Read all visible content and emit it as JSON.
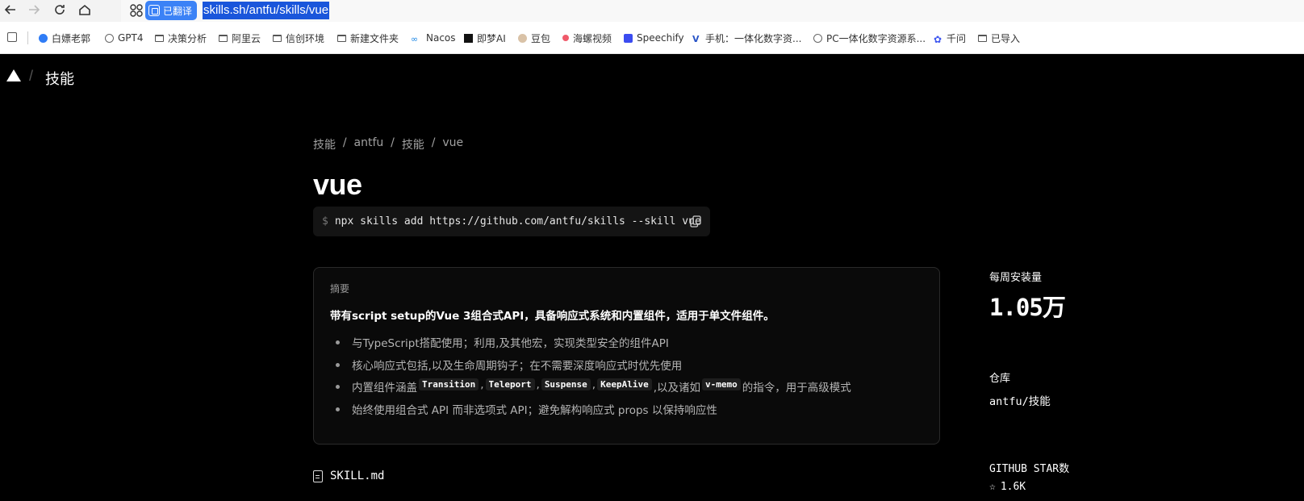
{
  "browser": {
    "translated_badge": "已翻译",
    "url": "skills.sh/antfu/skills/vue"
  },
  "bookmarks": [
    {
      "label": "白嫖老郭",
      "icon": "globe-icon"
    },
    {
      "label": "GPT4",
      "icon": "openai-icon"
    },
    {
      "label": "决策分析",
      "icon": "folder-icon"
    },
    {
      "label": "阿里云",
      "icon": "folder-icon"
    },
    {
      "label": "信创环境",
      "icon": "folder-icon"
    },
    {
      "label": "新建文件夹",
      "icon": "folder-icon"
    },
    {
      "label": "Nacos",
      "icon": "nacos-icon"
    },
    {
      "label": "即梦AI",
      "icon": "jimeng-icon"
    },
    {
      "label": "豆包",
      "icon": "doubao-icon"
    },
    {
      "label": "海螺视频",
      "icon": "hailuo-icon"
    },
    {
      "label": "Speechify",
      "icon": "speechify-icon"
    },
    {
      "label": "手机：一体化数字资...",
      "icon": "v-icon"
    },
    {
      "label": "PC一体化数字资源系...",
      "icon": "openai-icon"
    },
    {
      "label": "千问",
      "icon": "qianwen-icon"
    },
    {
      "label": "已导入",
      "icon": "folder-icon"
    }
  ],
  "header": {
    "separator": "/",
    "crumb": "技能"
  },
  "breadcrumb": [
    "技能",
    "antfu",
    "技能",
    "vue"
  ],
  "title": "vue",
  "command": {
    "prompt": "$",
    "text": "npx skills add https://github.com/antfu/skills --skill vue"
  },
  "summary": {
    "label": "摘要",
    "description": "带有script setup的Vue 3组合式API，具备响应式系统和内置组件，适用于单文件组件。",
    "bullets": [
      "与TypeScript搭配使用；利用,及其他宏，实现类型安全的组件API",
      "核心响应式包括,以及生命周期钩子；在不需要深度响应式时优先使用",
      "始终使用组合式 API 而非选项式 API；避免解构响应式 props 以保持响应性"
    ],
    "bullet3": {
      "prefix": "内置组件涵盖",
      "chips": [
        "Transition",
        "Teleport",
        "Suspense",
        "KeepAlive"
      ],
      "sep": ",",
      "middle": ",以及诸如",
      "chip_last": "v-memo",
      "suffix": "的指令，用于高级模式"
    }
  },
  "file": "SKILL.md",
  "sidebar": {
    "weekly_label": "每周安装量",
    "weekly_value": "1.05万",
    "repo_label": "仓库",
    "repo_value": "antfu/技能",
    "stars_label": "GITHUB STAR数",
    "stars_value": "1.6K"
  }
}
